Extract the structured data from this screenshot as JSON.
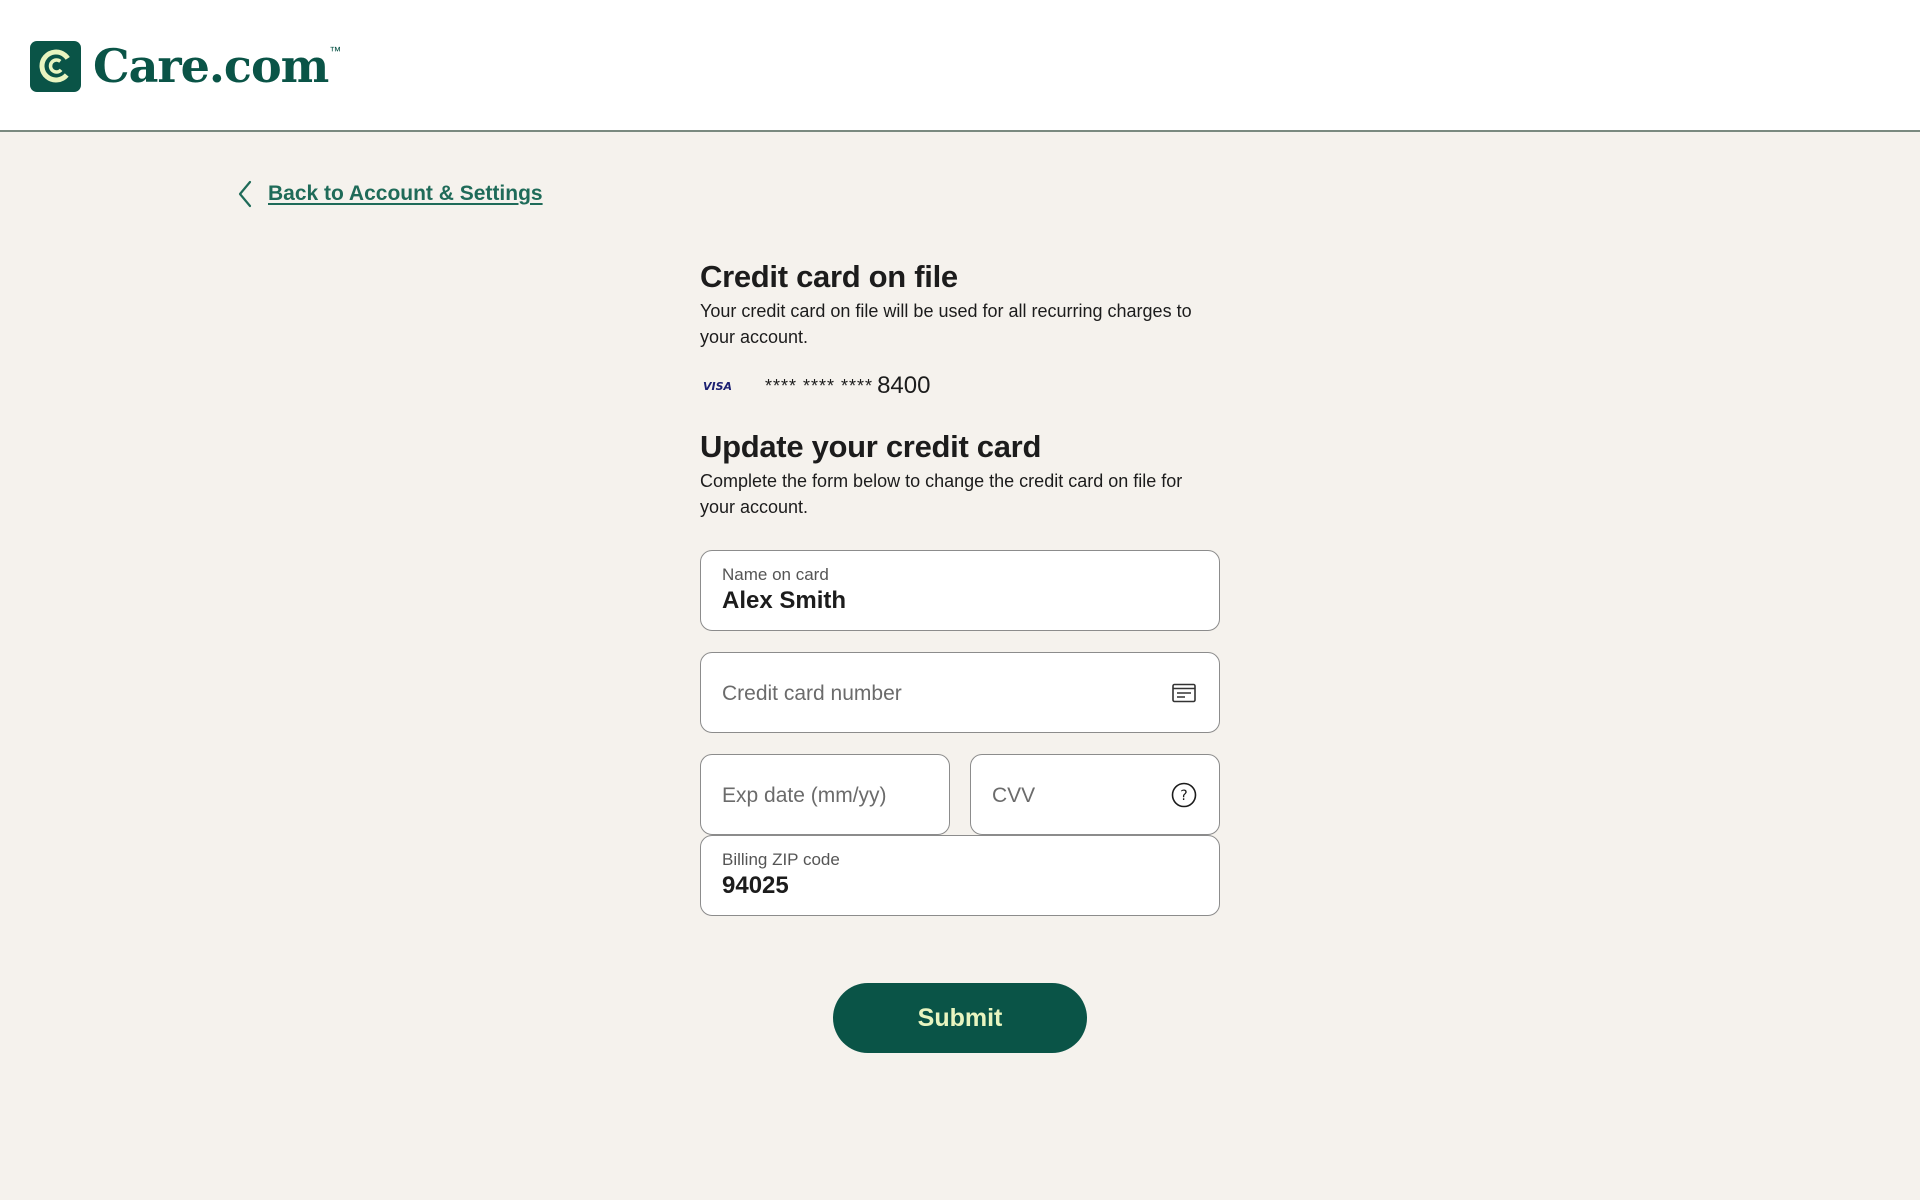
{
  "header": {
    "logo_text": "Care.com",
    "logo_tm": "™",
    "brand_color": "#0a5447"
  },
  "nav": {
    "back_label": "Back to Account & Settings"
  },
  "card_on_file": {
    "title": "Credit card on file",
    "description": "Your credit card on file will be used for all recurring charges to your account.",
    "brand": "VISA",
    "masked": "**** **** ****",
    "last4": "8400"
  },
  "update": {
    "title": "Update your credit card",
    "description": "Complete the form below to change the credit card on file for your account."
  },
  "form": {
    "name_label": "Name on card",
    "name_value": "Alex Smith",
    "card_number_placeholder": "Credit card number",
    "exp_placeholder": "Exp date (mm/yy)",
    "cvv_placeholder": "CVV",
    "zip_label": "Billing ZIP code",
    "zip_value": "94025",
    "submit_label": "Submit"
  },
  "icons": {
    "back": "chevron-left-icon",
    "card": "credit-card-icon",
    "cvv_help": "question-circle-icon"
  }
}
